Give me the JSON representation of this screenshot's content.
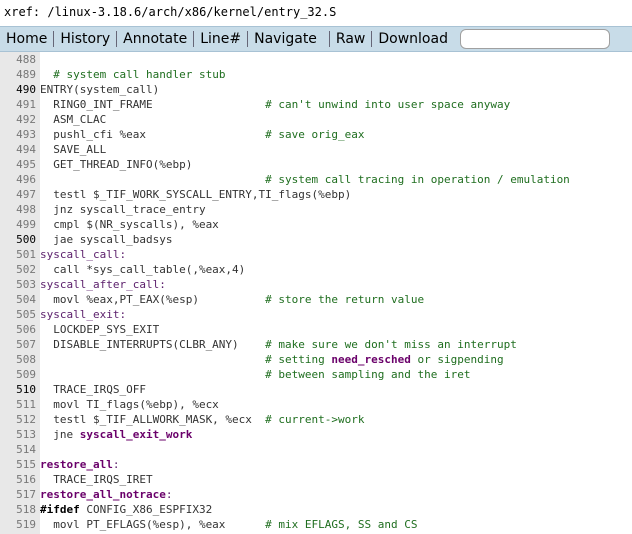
{
  "xref": {
    "label": "xref:",
    "path": " /linux-3.18.6/arch/x86/kernel/entry_32.S"
  },
  "toolbar": {
    "items": [
      "Home",
      "History",
      "Annotate",
      "Line#",
      "Navigate",
      "Raw",
      "Download"
    ],
    "search_placeholder": ""
  },
  "lines": [
    {
      "n": "488",
      "segments": []
    },
    {
      "n": "489",
      "segments": [
        {
          "t": "txt",
          "v": "  "
        },
        {
          "t": "cm",
          "v": "# system call handler stub"
        }
      ]
    },
    {
      "n": "490",
      "bold": true,
      "segments": [
        {
          "t": "txt",
          "v": "ENTRY(system_call)"
        }
      ]
    },
    {
      "n": "491",
      "segments": [
        {
          "t": "txt",
          "v": "  RING0_INT_FRAME                 "
        },
        {
          "t": "cm",
          "v": "# can't unwind into user space anyway"
        }
      ]
    },
    {
      "n": "492",
      "segments": [
        {
          "t": "txt",
          "v": "  ASM_CLAC"
        }
      ]
    },
    {
      "n": "493",
      "segments": [
        {
          "t": "txt",
          "v": "  pushl_cfi %eax                  "
        },
        {
          "t": "cm",
          "v": "# save orig_eax"
        }
      ]
    },
    {
      "n": "494",
      "segments": [
        {
          "t": "txt",
          "v": "  SAVE_ALL"
        }
      ]
    },
    {
      "n": "495",
      "segments": [
        {
          "t": "txt",
          "v": "  GET_THREAD_INFO(%ebp)"
        }
      ]
    },
    {
      "n": "496",
      "segments": [
        {
          "t": "txt",
          "v": "                                  "
        },
        {
          "t": "cm",
          "v": "# system call tracing in operation / emulation"
        }
      ]
    },
    {
      "n": "497",
      "segments": [
        {
          "t": "txt",
          "v": "  testl $_TIF_WORK_SYSCALL_ENTRY,TI_flags(%ebp)"
        }
      ]
    },
    {
      "n": "498",
      "segments": [
        {
          "t": "txt",
          "v": "  jnz syscall_trace_entry"
        }
      ]
    },
    {
      "n": "499",
      "segments": [
        {
          "t": "txt",
          "v": "  cmpl $(NR_syscalls), %eax"
        }
      ]
    },
    {
      "n": "500",
      "bold": true,
      "segments": [
        {
          "t": "txt",
          "v": "  jae syscall_badsys"
        }
      ]
    },
    {
      "n": "501",
      "segments": [
        {
          "t": "lbl",
          "v": "syscall_call:"
        }
      ]
    },
    {
      "n": "502",
      "segments": [
        {
          "t": "txt",
          "v": "  call *sys_call_table(,%eax,4)"
        }
      ]
    },
    {
      "n": "503",
      "segments": [
        {
          "t": "lbl",
          "v": "syscall_after_call:"
        }
      ]
    },
    {
      "n": "504",
      "segments": [
        {
          "t": "txt",
          "v": "  movl %eax,PT_EAX(%esp)          "
        },
        {
          "t": "cm",
          "v": "# store the return value"
        }
      ]
    },
    {
      "n": "505",
      "segments": [
        {
          "t": "lbl",
          "v": "syscall_exit:"
        }
      ]
    },
    {
      "n": "506",
      "segments": [
        {
          "t": "txt",
          "v": "  LOCKDEP_SYS_EXIT"
        }
      ]
    },
    {
      "n": "507",
      "segments": [
        {
          "t": "txt",
          "v": "  DISABLE_INTERRUPTS(CLBR_ANY)    "
        },
        {
          "t": "cm",
          "v": "# make sure we don't miss an interrupt"
        }
      ]
    },
    {
      "n": "508",
      "segments": [
        {
          "t": "txt",
          "v": "                                  "
        },
        {
          "t": "cm",
          "v": "# setting "
        },
        {
          "t": "fn",
          "v": "need_resched"
        },
        {
          "t": "cm",
          "v": " or sigpending"
        }
      ]
    },
    {
      "n": "509",
      "segments": [
        {
          "t": "txt",
          "v": "                                  "
        },
        {
          "t": "cm",
          "v": "# between sampling and the iret"
        }
      ]
    },
    {
      "n": "510",
      "bold": true,
      "segments": [
        {
          "t": "txt",
          "v": "  TRACE_IRQS_OFF"
        }
      ]
    },
    {
      "n": "511",
      "segments": [
        {
          "t": "txt",
          "v": "  movl TI_flags(%ebp), %ecx"
        }
      ]
    },
    {
      "n": "512",
      "segments": [
        {
          "t": "txt",
          "v": "  testl $_TIF_ALLWORK_MASK, %ecx  "
        },
        {
          "t": "cm",
          "v": "# current->work"
        }
      ]
    },
    {
      "n": "513",
      "segments": [
        {
          "t": "txt",
          "v": "  jne "
        },
        {
          "t": "fn",
          "v": "syscall_exit_work"
        }
      ]
    },
    {
      "n": "514",
      "segments": []
    },
    {
      "n": "515",
      "segments": [
        {
          "t": "fn",
          "v": "restore_all"
        },
        {
          "t": "lbl",
          "v": ":"
        }
      ]
    },
    {
      "n": "516",
      "segments": [
        {
          "t": "txt",
          "v": "  TRACE_IRQS_IRET"
        }
      ]
    },
    {
      "n": "517",
      "segments": [
        {
          "t": "fn",
          "v": "restore_all_notrace"
        },
        {
          "t": "lbl",
          "v": ":"
        }
      ]
    },
    {
      "n": "518",
      "segments": [
        {
          "t": "kw",
          "v": "#ifdef"
        },
        {
          "t": "txt",
          "v": " CONFIG_X86_ESPFIX32"
        }
      ]
    },
    {
      "n": "519",
      "segments": [
        {
          "t": "txt",
          "v": "  movl PT_EFLAGS(%esp), %eax      "
        },
        {
          "t": "cm",
          "v": "# mix EFLAGS, SS and CS"
        }
      ]
    }
  ]
}
